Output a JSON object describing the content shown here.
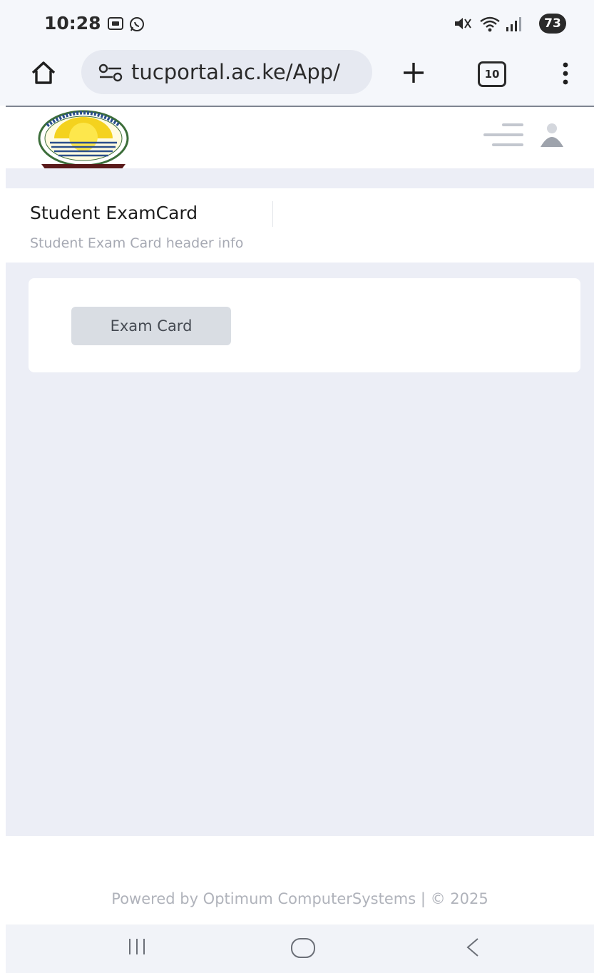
{
  "status_bar": {
    "time": "10:28",
    "battery": "73",
    "left_icons": [
      "screen-record-icon",
      "whatsapp-icon"
    ],
    "right_icons": [
      "mute-icon",
      "wifi-icon",
      "signal-icon"
    ]
  },
  "browser": {
    "url": "tucportal.ac.ke/App/",
    "tab_count": "10",
    "buttons": [
      "home-icon",
      "site-settings-icon",
      "new-tab-icon",
      "tab-switcher",
      "more-menu-icon"
    ]
  },
  "app_header": {
    "logo_alt": "Turkana University College",
    "logo_motto": "The Cradle of Knowledge",
    "icons": [
      "menu-icon",
      "user-icon"
    ]
  },
  "page": {
    "title": "Student ExamCard",
    "subtitle": "Student Exam Card header info"
  },
  "card": {
    "button_label": "Exam Card"
  },
  "footer": {
    "text": "Powered by Optimum ComputerSystems | © 2025"
  },
  "colors": {
    "background": "#eceef6",
    "card": "#ffffff",
    "button": "#d9dde3",
    "muted_text": "#a6a9b3"
  }
}
